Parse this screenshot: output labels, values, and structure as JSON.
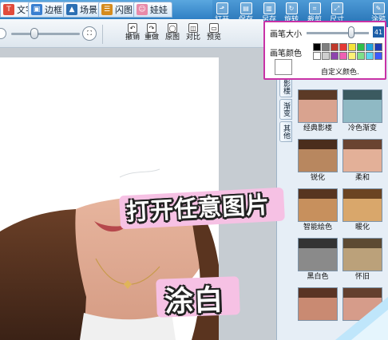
{
  "tabs": [
    {
      "label": "文字",
      "icon": "text-icon",
      "color": "#e14b3b"
    },
    {
      "label": "边框",
      "icon": "frame-icon",
      "color": "#3a7fd0"
    },
    {
      "label": "场景",
      "icon": "scene-icon",
      "color": "#2b6fb3"
    },
    {
      "label": "闪图",
      "icon": "flash-icon",
      "color": "#d58b1d"
    },
    {
      "label": "娃娃",
      "icon": "doll-icon",
      "color": "#e88aa9"
    }
  ],
  "tools": [
    {
      "label": "打开",
      "icon": "open-icon"
    },
    {
      "label": "保存",
      "icon": "save-icon"
    },
    {
      "label": "另存",
      "icon": "save-as-icon"
    },
    {
      "label": "旋转",
      "icon": "rotate-icon"
    },
    {
      "label": "裁剪",
      "icon": "crop-icon"
    },
    {
      "label": "尺寸",
      "icon": "resize-icon"
    },
    {
      "label": "涂鸦",
      "icon": "doodle-icon"
    }
  ],
  "toolbar2": {
    "undo": "撤销",
    "redo": "重做",
    "original": "原图",
    "compare": "对比",
    "preview": "预览"
  },
  "brush_popup": {
    "size_label": "画笔大小",
    "size_value": "41",
    "size_fraction": 0.72,
    "color_label": "画笔颜色",
    "current_color": "#ffffff",
    "swatches": [
      "#000000",
      "#7f7f7f",
      "#c0392b",
      "#e53935",
      "#f4e23a",
      "#2fbf4a",
      "#1fa2e0",
      "#1f3bb3",
      "#ffffff",
      "#cfcfcf",
      "#8e44ad",
      "#ef5fb3",
      "#fff176",
      "#7ee08a",
      "#5bd6f0",
      "#3d5afe"
    ],
    "custom_label": "自定义颜色."
  },
  "side_tabs": [
    "影楼",
    "渐变",
    "其他"
  ],
  "filters": [
    {
      "label": "经典影楼",
      "tint": "#d9a38f"
    },
    {
      "label": "冷色渐变",
      "tint": "#8fb9c4"
    },
    {
      "label": "锐化",
      "tint": "#b8875f"
    },
    {
      "label": "柔和",
      "tint": "#e3b098"
    },
    {
      "label": "智能绘色",
      "tint": "#c7905d"
    },
    {
      "label": "暖化",
      "tint": "#d9a76b"
    },
    {
      "label": "黑白色",
      "tint": "#8a8a8a"
    },
    {
      "label": "怀旧",
      "tint": "#bba17a"
    },
    {
      "label": "",
      "tint": "#c98a72"
    },
    {
      "label": "",
      "tint": "#d69c8a"
    }
  ],
  "captions": {
    "open_any": "打开任意图片",
    "paint_white": "涂白"
  },
  "colors": {
    "accent_blue": "#2f7fc4",
    "highlight_magenta": "#c832a6",
    "caption_pink": "#f6c1e4"
  }
}
